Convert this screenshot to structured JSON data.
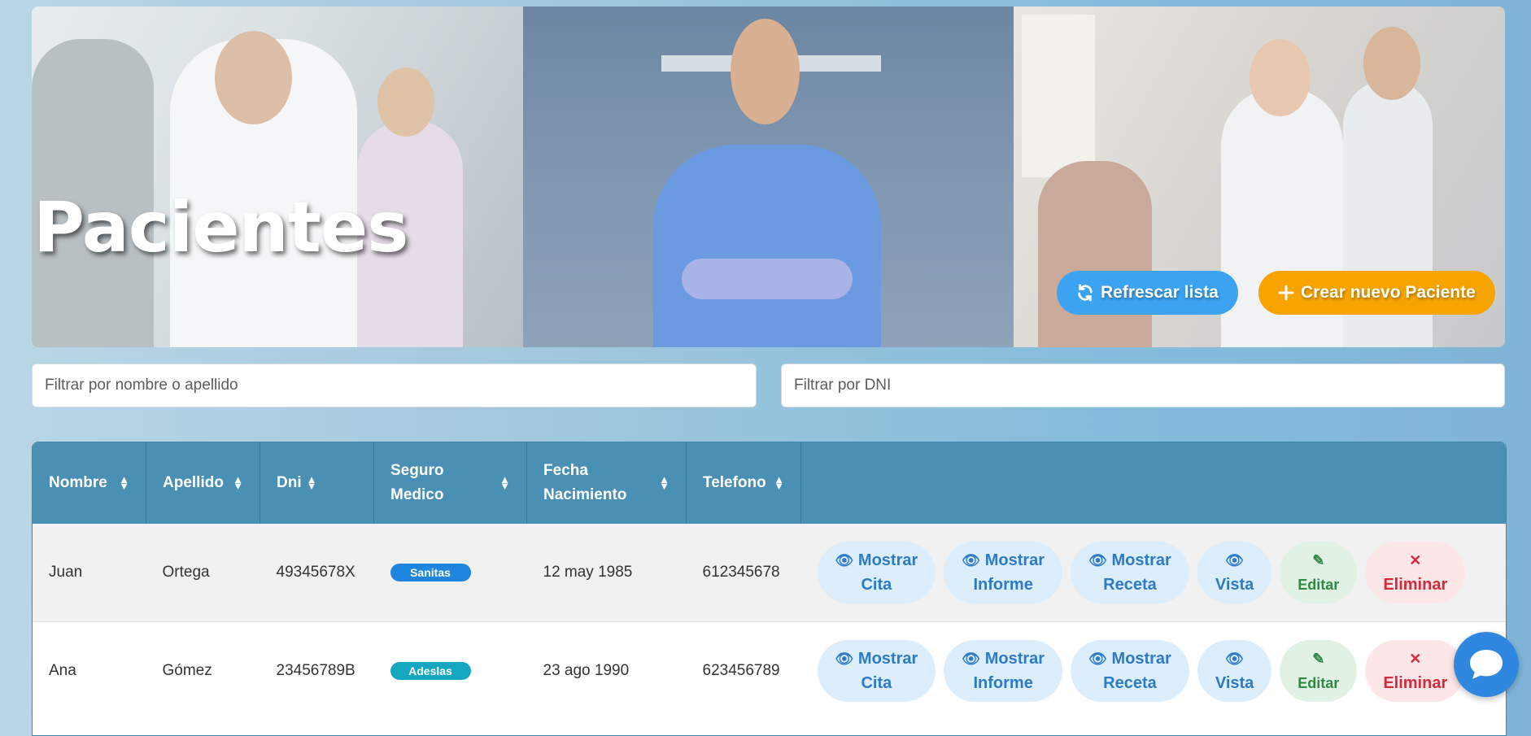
{
  "hero": {
    "title": "Pacientes",
    "refresh_label": "Refrescar lista",
    "create_label": "Crear nuevo Paciente",
    "refresh_icon": "refresh-icon",
    "create_icon": "plus-icon"
  },
  "filters": {
    "name_placeholder": "Filtrar por nombre o apellido",
    "dni_placeholder": "Filtrar por DNI"
  },
  "table": {
    "headers": [
      "Nombre",
      "Apellido",
      "Dni",
      "Seguro Medico",
      "Fecha Nacimiento",
      "Telefono"
    ],
    "rows": [
      {
        "nombre": "Juan",
        "apellido": "Ortega",
        "dni": "49345678X",
        "seguro": "Sanitas",
        "seguro_color": "#1f86e0",
        "fecha": "12 may 1985",
        "telefono": "612345678"
      },
      {
        "nombre": "Ana",
        "apellido": "Gómez",
        "dni": "23456789B",
        "seguro": "Adeslas",
        "seguro_color": "#13a8bf",
        "fecha": "23 ago 1990",
        "telefono": "623456789"
      }
    ],
    "actions": {
      "cita_1": "Mostrar",
      "cita_2": "Cita",
      "informe_1": "Mostrar",
      "informe_2": "Informe",
      "receta_1": "Mostrar",
      "receta_2": "Receta",
      "vista": "Vista",
      "editar": "Editar",
      "eliminar": "Eliminar"
    }
  },
  "colors": {
    "header_bg": "#4a90b4",
    "refresh_bg": "#3ba3f2",
    "create_bg": "#f7a400",
    "chat_bg": "#2f87e0"
  }
}
